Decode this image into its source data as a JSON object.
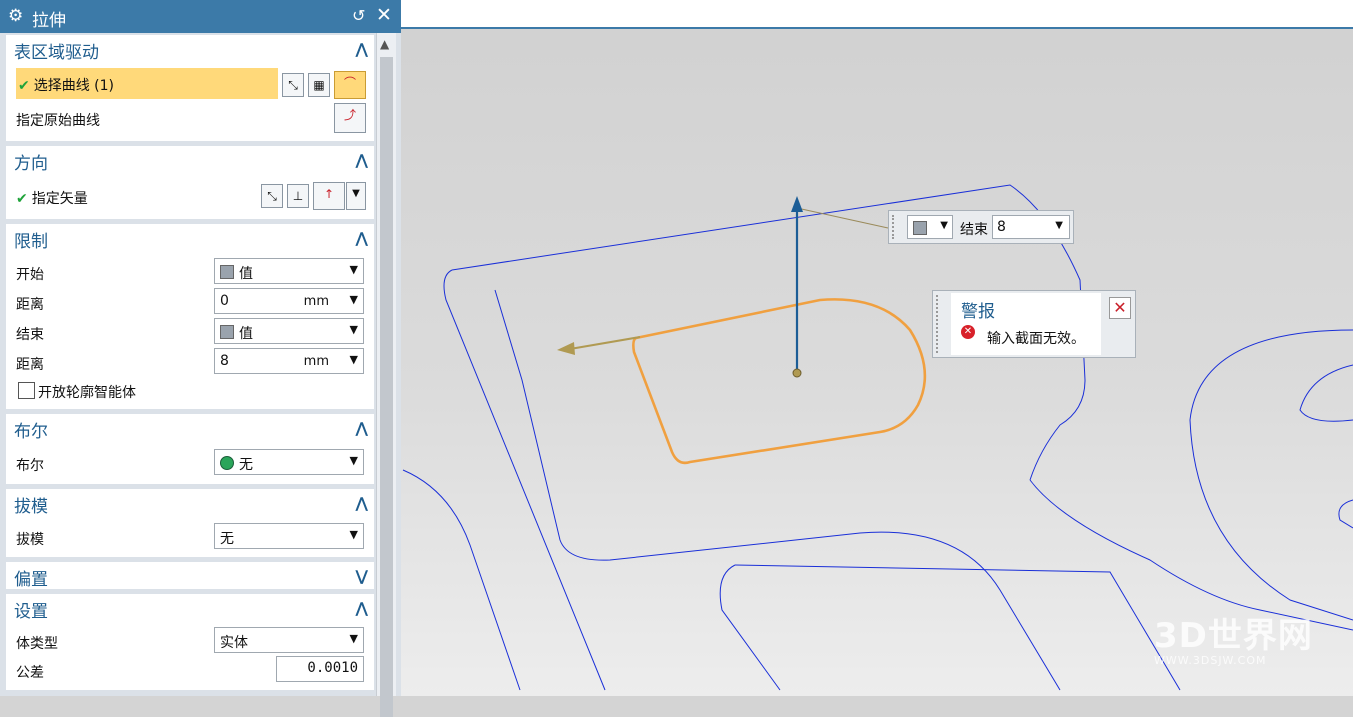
{
  "dialog": {
    "title": "拉伸"
  },
  "section_curve": {
    "title": "表区域驱动",
    "select_curve": "选择曲线 (1)",
    "original_curve": "指定原始曲线"
  },
  "section_direction": {
    "title": "方向",
    "vector": "指定矢量"
  },
  "section_limits": {
    "title": "限制",
    "start_label": "开始",
    "start_value": "值",
    "dist1_label": "距离",
    "dist1_value": "0",
    "dist1_unit": "mm",
    "end_label": "结束",
    "end_value": "值",
    "dist2_label": "距离",
    "dist2_value": "8",
    "dist2_unit": "mm",
    "open_profile": "开放轮廓智能体"
  },
  "section_bool": {
    "title": "布尔",
    "label": "布尔",
    "value": "无"
  },
  "section_draft": {
    "title": "拔模",
    "label": "拔模",
    "value": "无"
  },
  "section_offset": {
    "title": "偏置"
  },
  "section_settings": {
    "title": "设置",
    "body_label": "体类型",
    "body_value": "实体",
    "tol_label": "公差",
    "tol_value": "0.0010"
  },
  "viewport": {
    "end_handle": {
      "label": "结束",
      "value": "8"
    },
    "alert": {
      "title": "警报",
      "message": "输入截面无效。"
    }
  },
  "watermark": {
    "brand": "3D世界网",
    "url": "WWW.3DSJW.COM"
  },
  "colors": {
    "title_bar": "#3c7aa8",
    "highlight": "#ffd97a",
    "section_title": "#1f5d8e",
    "curve_orange": "#f0a040",
    "edge_blue": "#1a2fd8"
  }
}
